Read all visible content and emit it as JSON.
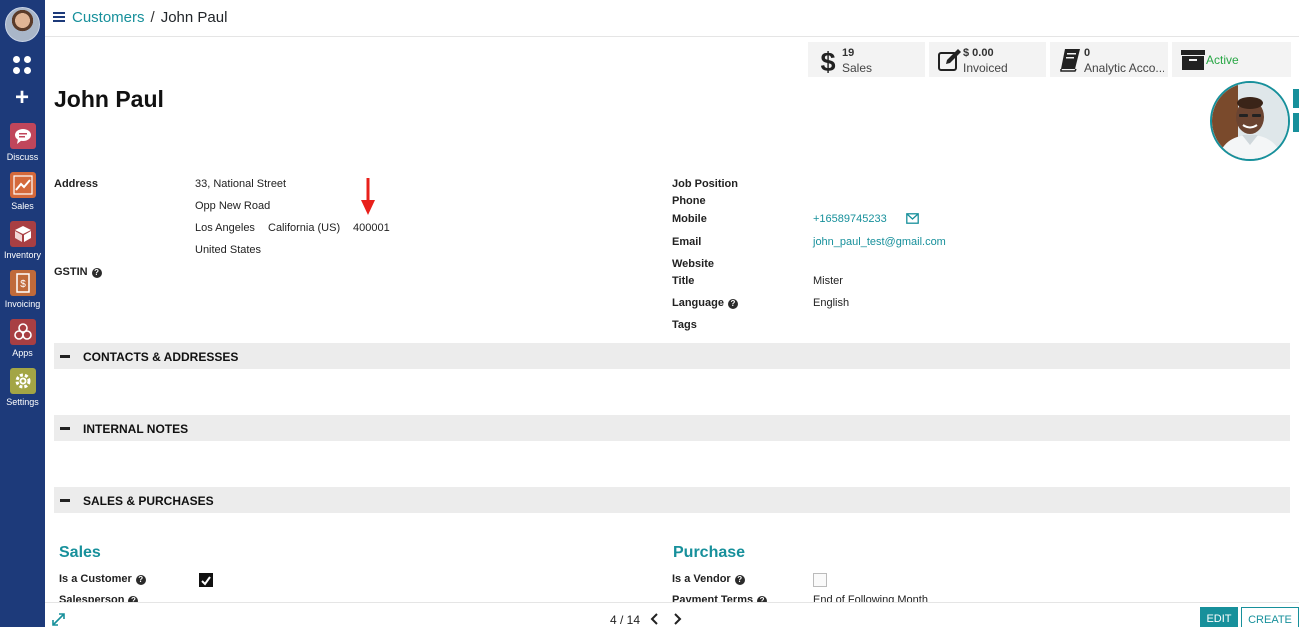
{
  "sidebar": {
    "apps": [
      {
        "label": "Discuss",
        "color": "#c0465b"
      },
      {
        "label": "Sales",
        "color": "#d4693b"
      },
      {
        "label": "Inventory",
        "color": "#a83f43"
      },
      {
        "label": "Invoicing",
        "color": "#c06a3a"
      },
      {
        "label": "Apps",
        "color": "#a83f43"
      },
      {
        "label": "Settings",
        "color": "#a3a545"
      }
    ]
  },
  "breadcrumb": {
    "parent": "Customers",
    "separator": "/",
    "current": "John Paul"
  },
  "stats": {
    "sales": {
      "value": "19",
      "label": "Sales"
    },
    "invoiced": {
      "value": "$ 0.00",
      "label": "Invoiced"
    },
    "analytic": {
      "value": "0",
      "label": "Analytic Acco..."
    },
    "active": {
      "label": "Active"
    }
  },
  "record": {
    "name": "John Paul",
    "address_label": "Address",
    "street": "33, National Street",
    "street2": "Opp New Road",
    "city": "Los Angeles",
    "state": "California (US)",
    "zip": "400001",
    "country": "United States",
    "gstin_label": "GSTIN",
    "job_position_label": "Job Position",
    "phone_label": "Phone",
    "mobile_label": "Mobile",
    "mobile": "+16589745233",
    "email_label": "Email",
    "email": "john_paul_test@gmail.com",
    "website_label": "Website",
    "title_label": "Title",
    "title_value": "Mister",
    "language_label": "Language",
    "language_value": "English",
    "tags_label": "Tags"
  },
  "sections": {
    "contacts": "CONTACTS & ADDRESSES",
    "notes": "INTERNAL NOTES",
    "sales_purchases": "SALES & PURCHASES"
  },
  "sales_purchase": {
    "sales_heading": "Sales",
    "is_customer_label": "Is a Customer",
    "is_customer": true,
    "salesperson_label": "Salesperson",
    "purchase_heading": "Purchase",
    "is_vendor_label": "Is a Vendor",
    "is_vendor": false,
    "payment_terms_label": "Payment Terms",
    "payment_terms_value": "End of Following Month"
  },
  "pager": {
    "text": "4 / 14"
  },
  "buttons": {
    "edit": "EDIT",
    "create": "CREATE"
  },
  "colors": {
    "accent": "#17909b",
    "sidebar": "#1d3a7a",
    "annotation_arrow": "#e8201b",
    "active": "#28a745"
  }
}
